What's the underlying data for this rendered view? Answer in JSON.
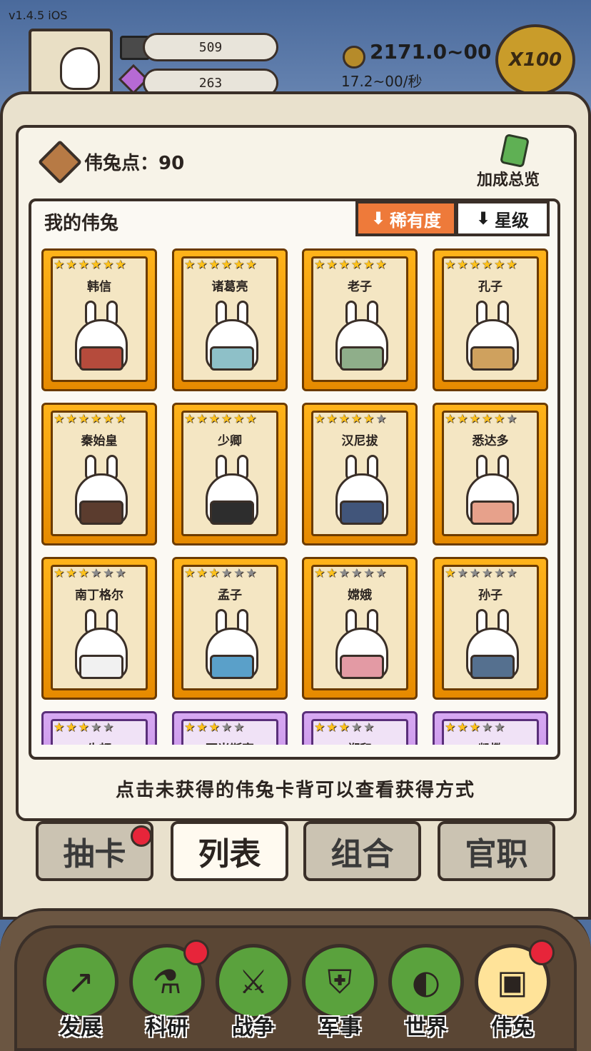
{
  "hud": {
    "version": "v1.4.5 iOS",
    "stone": "509",
    "gem": "263",
    "coin_total": "2171.0~00",
    "coin_rate": "17.2~00/秒",
    "multiplier": "X100"
  },
  "panel": {
    "points_label": "伟兔点：90",
    "bonus_overview": "加成总览",
    "list_title": "我的伟兔",
    "sort_rarity": "稀有度",
    "sort_star": "星级",
    "hint": "点击未获得的伟兔卡背可以查看获得方式"
  },
  "cards": [
    {
      "name": "韩信",
      "stars": 6,
      "rarity": "gold",
      "robe": "#b54b3c"
    },
    {
      "name": "诸葛亮",
      "stars": 6,
      "rarity": "gold",
      "robe": "#8ec0c8"
    },
    {
      "name": "老子",
      "stars": 6,
      "rarity": "gold",
      "robe": "#8fae8a"
    },
    {
      "name": "孔子",
      "stars": 6,
      "rarity": "gold",
      "robe": "#cfa15e"
    },
    {
      "name": "秦始皇",
      "stars": 6,
      "rarity": "gold",
      "robe": "#5b3c2e"
    },
    {
      "name": "少卿",
      "stars": 6,
      "rarity": "gold",
      "robe": "#2d2d2d"
    },
    {
      "name": "汉尼拔",
      "stars": 5,
      "rarity": "gold",
      "robe": "#41557a"
    },
    {
      "name": "悉达多",
      "stars": 5,
      "rarity": "gold",
      "robe": "#e7a18b"
    },
    {
      "name": "南丁格尔",
      "stars": 3,
      "rarity": "gold",
      "robe": "#f1f1f1"
    },
    {
      "name": "孟子",
      "stars": 3,
      "rarity": "gold",
      "robe": "#5aa0c9"
    },
    {
      "name": "嫦娥",
      "stars": 2,
      "rarity": "gold",
      "robe": "#e39aa4"
    },
    {
      "name": "孙子",
      "stars": 1,
      "rarity": "gold",
      "robe": "#55708f"
    },
    {
      "name": "牛顿",
      "stars": 3,
      "rarity": "purple",
      "robe": "#d9c6a0"
    },
    {
      "name": "亚当斯密",
      "stars": 3,
      "rarity": "purple",
      "robe": "#d9c6a0"
    },
    {
      "name": "郑和",
      "stars": 3,
      "rarity": "purple",
      "robe": "#d9c6a0"
    },
    {
      "name": "凯撒",
      "stars": 3,
      "rarity": "purple",
      "robe": "#d9c6a0"
    }
  ],
  "tabs": {
    "draw": "抽卡",
    "list": "列表",
    "combo": "组合",
    "office": "官职"
  },
  "nav": {
    "develop": "发展",
    "research": "科研",
    "war": "战争",
    "military": "军事",
    "world": "世界",
    "bunny": "伟兔"
  }
}
